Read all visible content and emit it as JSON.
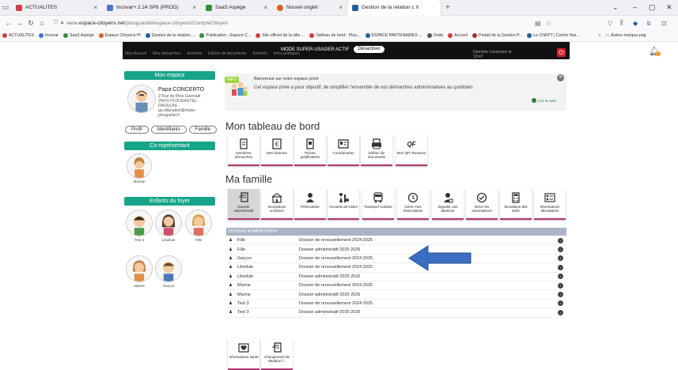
{
  "browser": {
    "tabs": [
      {
        "label": "ACTUALITES",
        "color": "#d04040"
      },
      {
        "label": "Incovar+ 2.24 SP8 (PROD)",
        "color": "#4a78c0"
      },
      {
        "label": "SaaS Arpège",
        "color": "#3a8a3a"
      },
      {
        "label": "Nouvel onglet",
        "color": "#e06020"
      },
      {
        "label": "Gestion de la relation c X",
        "color": "#2060a0"
      }
    ],
    "new_tab": "+",
    "url_prefix": "www.",
    "url_domain": "espace-citoyens.net",
    "url_path": "/plouguastel/espace-citoyens/CompteCitoyen",
    "bookmarks": [
      {
        "label": "ACTUALITES",
        "color": "#d04040"
      },
      {
        "label": "Incovar",
        "color": "#4a78c0"
      },
      {
        "label": "SaaS Arpège",
        "color": "#3a8a3a"
      },
      {
        "label": "Espace Citoyens Pl",
        "color": "#e06020"
      },
      {
        "label": "Gestion de la relation ...",
        "color": "#2060a0"
      },
      {
        "label": "Publication - Espace C...",
        "color": "#3a8a3a"
      },
      {
        "label": "Site officiel de la ville ...",
        "color": "#d04040"
      },
      {
        "label": "Tableau de bord - Plou...",
        "color": "#d04040"
      },
      {
        "label": "ESPACE PARTENAIRES ...",
        "color": "#2060a0"
      },
      {
        "label": "Onde",
        "color": "#555555"
      },
      {
        "label": "Accueil",
        "color": "#d04040"
      },
      {
        "label": "Portail de la Gestion P...",
        "color": "#a03030"
      },
      {
        "label": "Le CNFPT | Centre Nat...",
        "color": "#2060a0"
      }
    ],
    "bookmarks_more": "»",
    "other_bookmarks": "Autres marque-pag"
  },
  "topbar": {
    "nav_items": [
      "Mon Accueil",
      "Mes démarches",
      "Activités",
      "Édition de documents",
      "Activités",
      "Infos pratiques"
    ],
    "super_user_label": "MODE SUPER-USAGER ACTIF",
    "deactivate_label": "Désactiver",
    "right_line1": "Dernière connexion le",
    "right_line2": "13:47"
  },
  "sidebar": {
    "mon_espace": "Mon espace",
    "person_name": "Papa CONCERTO",
    "address_lines": [
      "2 Rue du Père Gwenaël",
      "29470 PLOUGASTEL-",
      "DAOULAS",
      "gu.education@marie-",
      "plougastel.fr"
    ],
    "pills": [
      "Profil",
      "Identifiants",
      "Famille"
    ],
    "co_representant": "Co-représentant",
    "co_name": "Maman",
    "enfants": "Enfants du foyer",
    "children": [
      "Test 3",
      "Libellule",
      "Fille",
      "Marine",
      "Garçon"
    ]
  },
  "welcome": {
    "badge": "INFO",
    "title": "Bienvenue sur votre espace privé",
    "text": "Cet espace privé a pour objectif, de simplifier l'ensemble de vos démarches administratives au quotidien",
    "link": "Lire la suite"
  },
  "dashboard": {
    "title": "Mon tableau de bord",
    "tiles": [
      {
        "label": "Dernières démarches",
        "icon": "document-icon"
      },
      {
        "label": "Mes factures",
        "icon": "euro-icon"
      },
      {
        "label": "Pièces justificatives",
        "icon": "files-icon"
      },
      {
        "label": "Coordonnées",
        "icon": "id-card-icon"
      },
      {
        "label": "Édition de documents",
        "icon": "printer-icon"
      },
      {
        "label": "Mon QF/ Revenus",
        "icon": "qf-icon"
      }
    ]
  },
  "family": {
    "title": "Ma famille",
    "tiles": [
      {
        "label": "Dossier administratif",
        "icon": "folder-icon"
      },
      {
        "label": "Inscriptions scolaires",
        "icon": "school-icon"
      },
      {
        "label": "Périscolaire",
        "icon": "child-icon"
      },
      {
        "label": "Accueils de loisirs",
        "icon": "leisure-icon"
      },
      {
        "label": "Transport scolaire",
        "icon": "bus-icon"
      },
      {
        "label": "Gérer mes réservations",
        "icon": "clock-icon"
      },
      {
        "label": "Signaler une absence",
        "icon": "person-absent-icon"
      },
      {
        "label": "Gérer les autorisations",
        "icon": "check-icon"
      },
      {
        "label": "Simulation des tarifs",
        "icon": "calculator-icon"
      },
      {
        "label": "Informations allocataires",
        "icon": "info-list-icon"
      }
    ]
  },
  "dossiers": {
    "header": "DOSSIER ADMINISTRATIF",
    "rows": [
      {
        "name": "Fille",
        "desc": "Dossier de renouvellement 2024 2025"
      },
      {
        "name": "Fille",
        "desc": "Dossier administratif 2025 2026"
      },
      {
        "name": "Garçon",
        "desc": "Dossier de renouvellement 2024 2025"
      },
      {
        "name": "Libellule",
        "desc": "Dossier de renouvellement 2024 2025"
      },
      {
        "name": "Libellule",
        "desc": "Dossier administratif 2025 2026"
      },
      {
        "name": "Marine",
        "desc": "Dossier de renouvellement 2024 2025"
      },
      {
        "name": "Marine",
        "desc": "Dossier administratif 2025 2026"
      },
      {
        "name": "Test 3",
        "desc": "Dossier de renouvellement 2024 2025"
      },
      {
        "name": "Test 3",
        "desc": "Dossier administratif 2025 2026"
      }
    ]
  },
  "bottom_tiles": [
    {
      "label": "Informations santé",
      "icon": "health-icon"
    },
    {
      "label": "Changement de situation f...",
      "icon": "change-icon"
    }
  ],
  "colors": {
    "accent": "#17a589",
    "tile_border": "#b23570",
    "arrow": "#3a6ec0",
    "power": "#d02030"
  }
}
